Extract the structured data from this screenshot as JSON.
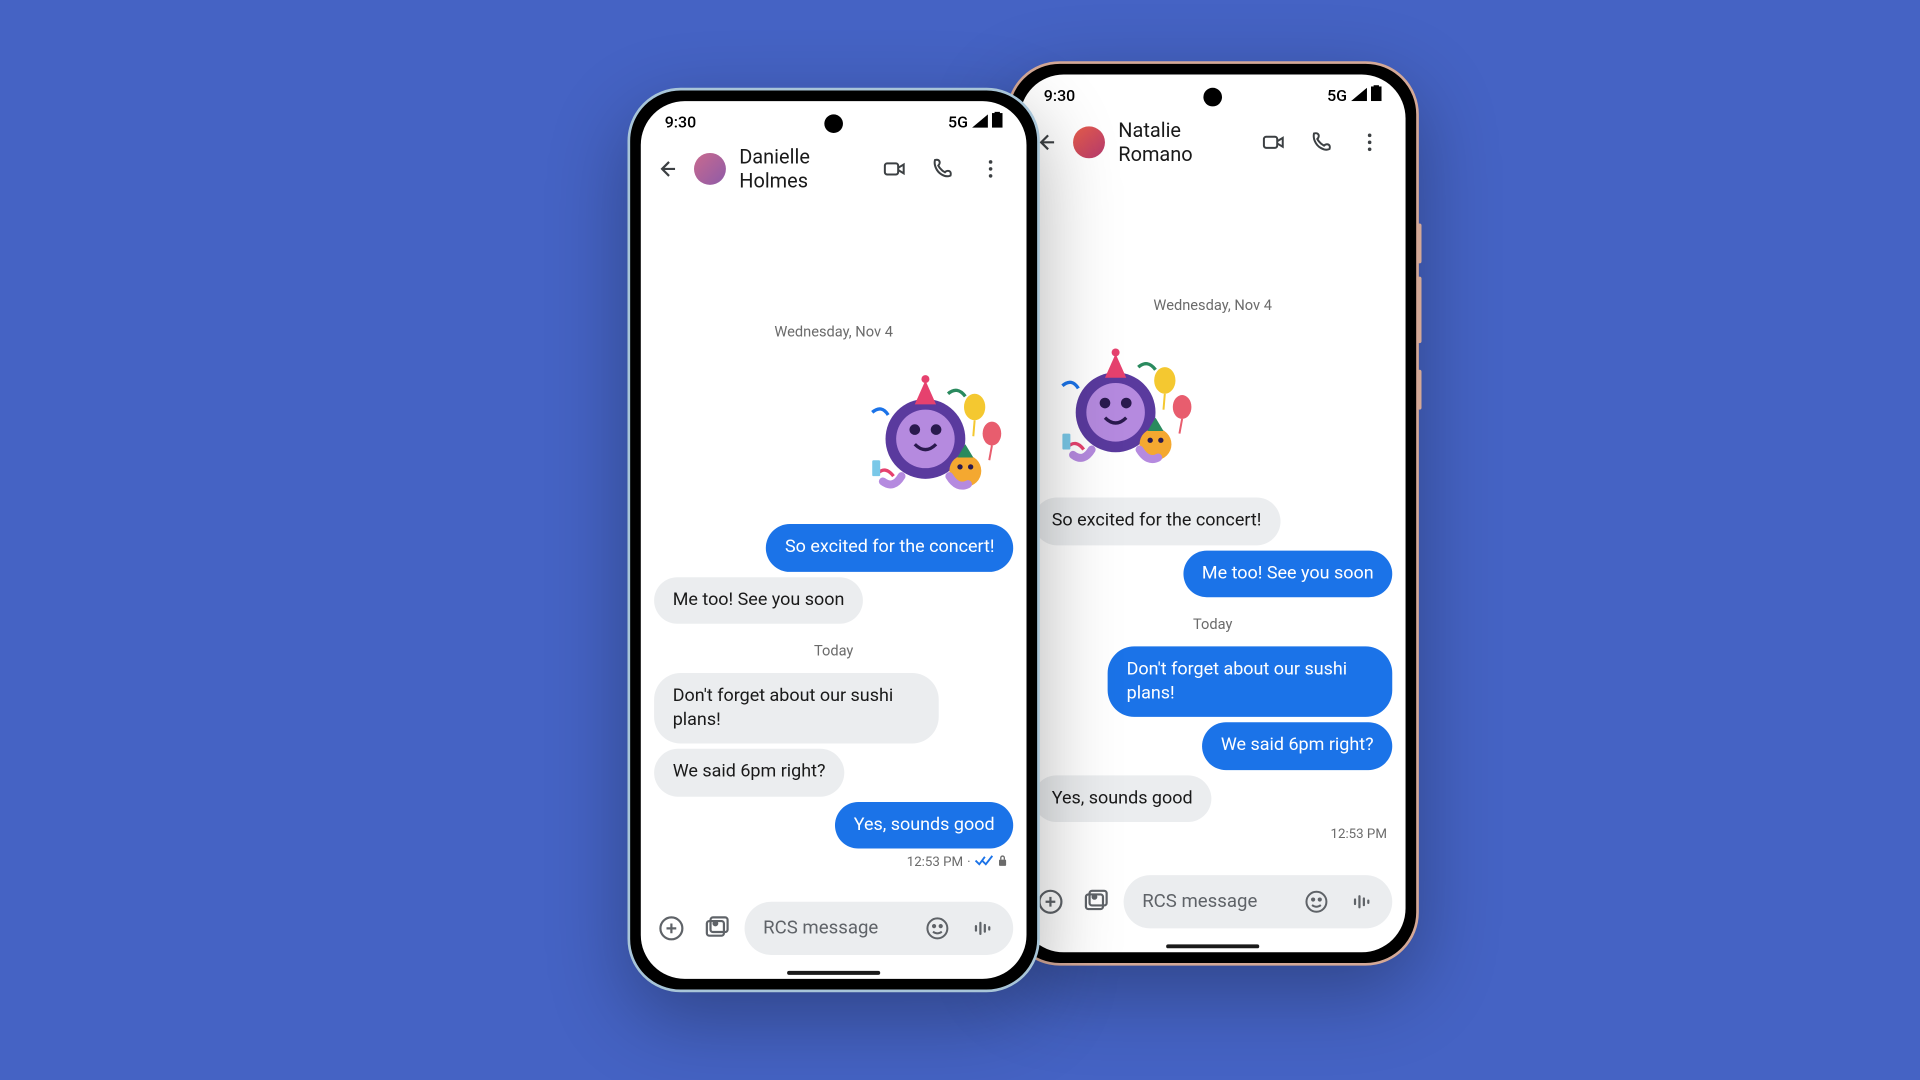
{
  "statusbar": {
    "time": "9:30",
    "network": "5G"
  },
  "phone_front": {
    "contact_name": "Danielle Holmes",
    "date1": "Wednesday, Nov 4",
    "msg_sent_1": "So excited for the concert!",
    "msg_recv_1": "Me too! See you soon",
    "date2": "Today",
    "msg_recv_2": "Don't forget about our sushi plans!",
    "msg_recv_3": "We said 6pm right?",
    "msg_sent_2": "Yes, sounds good",
    "status_time": "12:53 PM",
    "status_sep": "·",
    "input_placeholder": "RCS message"
  },
  "phone_back": {
    "contact_name": "Natalie Romano",
    "date1": "Wednesday, Nov 4",
    "msg_recv_1": "So excited for the concert!",
    "msg_sent_1": "Me too! See you soon",
    "date2": "Today",
    "msg_sent_2": "Don't forget about our sushi plans!",
    "msg_sent_3": "We said 6pm right?",
    "msg_recv_2": "Yes, sounds good",
    "status_time": "12:53 PM",
    "input_placeholder": "RCS message"
  },
  "colors": {
    "brand_blue": "#1b73e8",
    "bg": "#4563c4",
    "bubble_grey": "#ebedef"
  }
}
